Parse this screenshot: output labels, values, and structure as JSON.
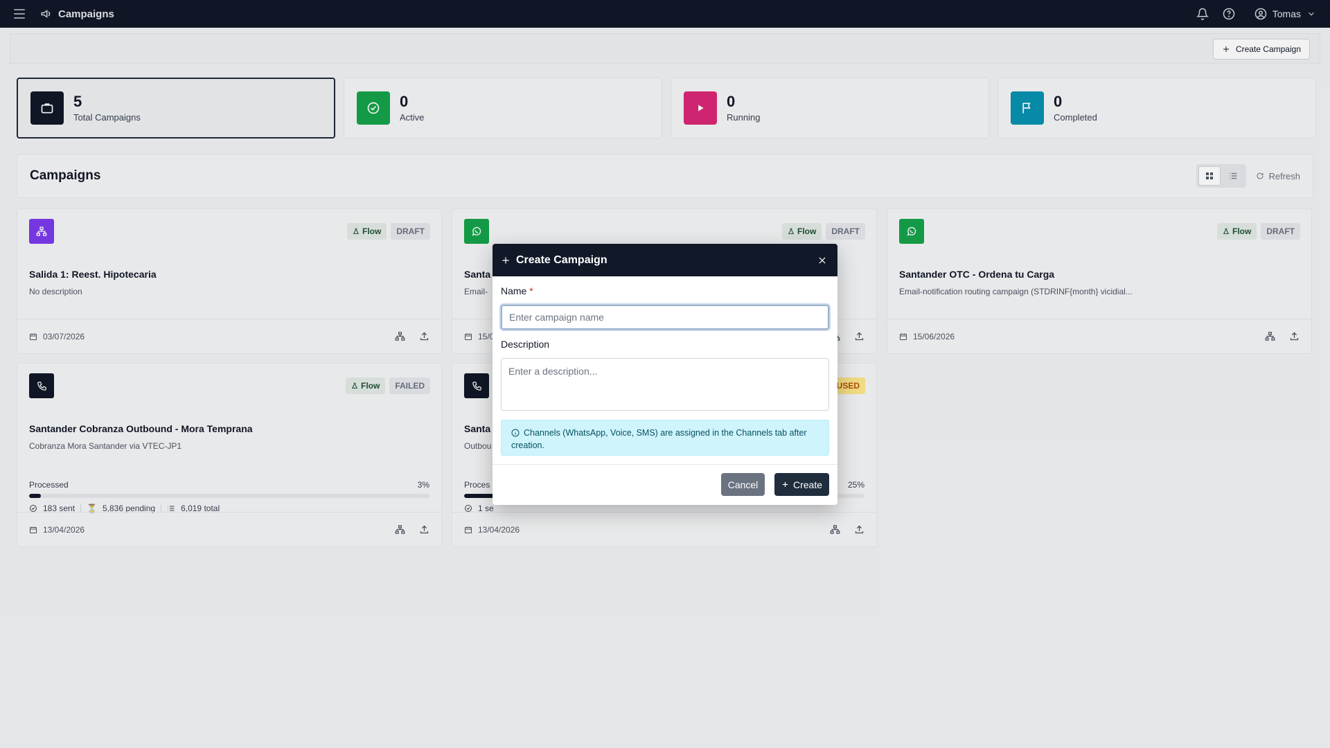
{
  "topbar": {
    "title": "Campaigns",
    "user_name": "Tomas"
  },
  "toolbar": {
    "create_label": "Create Campaign"
  },
  "stats": [
    {
      "value": "5",
      "label": "Total Campaigns",
      "color": "#111827",
      "icon": "briefcase-icon"
    },
    {
      "value": "0",
      "label": "Active",
      "color": "#16a34a",
      "icon": "check-circle-icon"
    },
    {
      "value": "0",
      "label": "Running",
      "color": "#db2777",
      "icon": "play-icon"
    },
    {
      "value": "0",
      "label": "Completed",
      "color": "#0891b2",
      "icon": "flag-icon"
    }
  ],
  "campaigns_section": {
    "title": "Campaigns",
    "refresh_label": "Refresh"
  },
  "campaigns": [
    {
      "title": "Salida 1: Reest. Hipotecaria",
      "description": "No description",
      "flow_label": "Flow",
      "status": "DRAFT",
      "date": "03/07/2026",
      "icon_color": "#7c3aed",
      "icon": "flow-icon"
    },
    {
      "title": "Santa",
      "description": "Email-",
      "flow_label": "Flow",
      "status": "DRAFT",
      "date": "15/0",
      "icon_color": "#16a34a",
      "icon": "whatsapp-icon"
    },
    {
      "title": "Santander OTC - Ordena tu Carga",
      "description": "Email-notification routing campaign (STDRINF{month} vicidial...",
      "flow_label": "Flow",
      "status": "DRAFT",
      "date": "15/06/2026",
      "icon_color": "#16a34a",
      "icon": "whatsapp-icon"
    },
    {
      "title": "Santander Cobranza Outbound - Mora Temprana",
      "description": "Cobranza Mora Santander via VTEC-JP1",
      "flow_label": "Flow",
      "status": "FAILED",
      "date": "13/04/2026",
      "icon_color": "#111827",
      "icon": "phone-icon",
      "progress": {
        "label": "Processed",
        "percent_text": "3%",
        "fraction": 0.03,
        "sent": "183 sent",
        "pending": "5,836 pending",
        "total": "6,019 total"
      }
    },
    {
      "title": "Santa",
      "description": "Outbou",
      "status": "USED",
      "date": "13/04/2026",
      "icon_color": "#111827",
      "icon": "phone-icon",
      "progress": {
        "label": "Proces",
        "percent_text": "25%",
        "fraction": 0.25,
        "sent": "1 se"
      }
    }
  ],
  "modal": {
    "title": "Create Campaign",
    "name_label": "Name",
    "required_mark": "*",
    "name_placeholder": "Enter campaign name",
    "name_value": "",
    "description_label": "Description",
    "description_placeholder": "Enter a description...",
    "info_text": "Channels (WhatsApp, Voice, SMS) are assigned in the Channels tab after creation.",
    "cancel_label": "Cancel",
    "create_label": "Create"
  }
}
